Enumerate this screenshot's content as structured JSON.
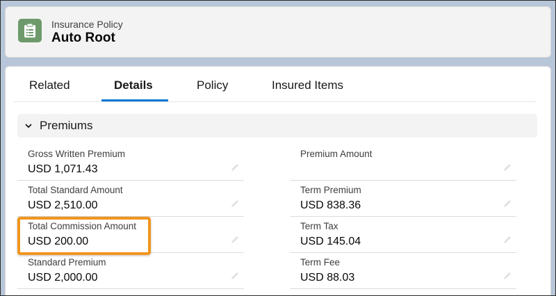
{
  "header": {
    "object_type": "Insurance Policy",
    "record_name": "Auto Root",
    "icon": "policy-clipboard-icon",
    "icon_color": "#6e9a6b"
  },
  "tabs": [
    {
      "label": "Related",
      "active": false
    },
    {
      "label": "Details",
      "active": true
    },
    {
      "label": "Policy",
      "active": false
    },
    {
      "label": "Insured Items",
      "active": false
    }
  ],
  "section": {
    "label": "Premiums",
    "expanded": true
  },
  "fields": {
    "left": [
      {
        "label": "Gross Written Premium",
        "value": "USD 1,071.43"
      },
      {
        "label": "Total Standard Amount",
        "value": "USD 2,510.00"
      },
      {
        "label": "Total Commission Amount",
        "value": "USD 200.00"
      },
      {
        "label": "Standard Premium",
        "value": "USD 2,000.00"
      }
    ],
    "right": [
      {
        "label": "Premium Amount",
        "value": ""
      },
      {
        "label": "Term Premium",
        "value": "USD 838.36"
      },
      {
        "label": "Term Tax",
        "value": "USD 145.04"
      },
      {
        "label": "Term Fee",
        "value": "USD 88.03"
      }
    ]
  },
  "colors": {
    "active_tab_underline": "#0176d3",
    "highlight_border": "#f0961e"
  }
}
